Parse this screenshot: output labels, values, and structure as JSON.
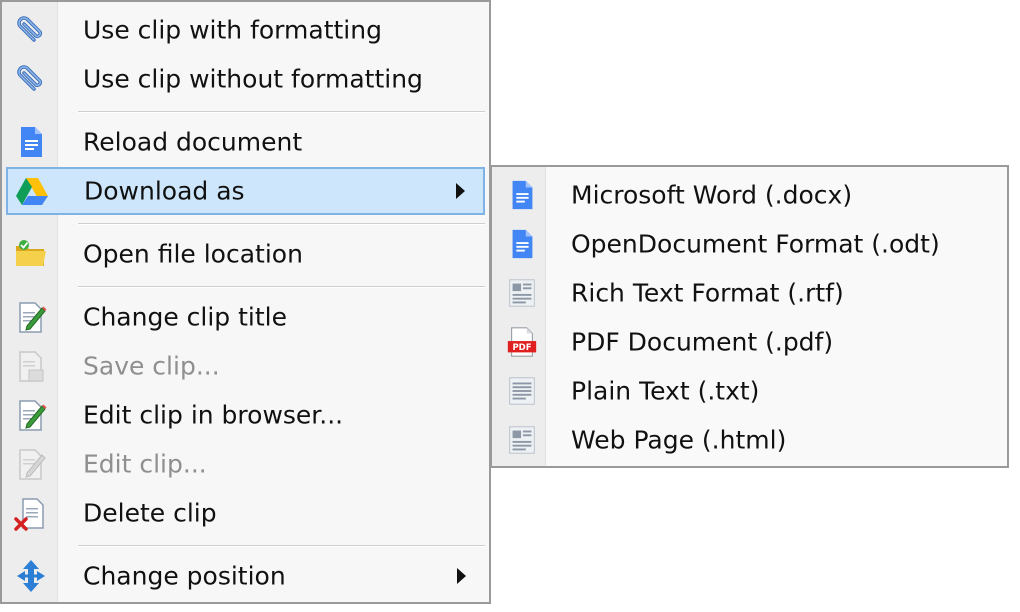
{
  "main_menu": {
    "items": [
      {
        "label": "Use clip with formatting",
        "icon": "paperclip-icon",
        "enabled": true
      },
      {
        "label": "Use clip without formatting",
        "icon": "paperclip-icon",
        "enabled": true
      },
      {
        "label": "Reload document",
        "icon": "google-doc-icon",
        "enabled": true
      },
      {
        "label": "Download as",
        "icon": "google-drive-icon",
        "enabled": true,
        "submenu": true,
        "highlighted": true
      },
      {
        "label": "Open file location",
        "icon": "folder-icon",
        "enabled": true
      },
      {
        "label": "Change clip title",
        "icon": "edit-page-icon",
        "enabled": true
      },
      {
        "label": "Save clip...",
        "icon": "save-page-icon",
        "enabled": false
      },
      {
        "label": "Edit clip in browser...",
        "icon": "edit-page-icon",
        "enabled": true
      },
      {
        "label": "Edit clip...",
        "icon": "edit-page-icon",
        "enabled": false
      },
      {
        "label": "Delete clip",
        "icon": "delete-page-icon",
        "enabled": true
      },
      {
        "label": "Change position",
        "icon": "move-arrows-icon",
        "enabled": true,
        "submenu": true
      }
    ]
  },
  "download_submenu": {
    "items": [
      {
        "label": "Microsoft Word (.docx)",
        "icon": "google-doc-icon"
      },
      {
        "label": "OpenDocument Format (.odt)",
        "icon": "google-doc-icon"
      },
      {
        "label": "Rich Text Format (.rtf)",
        "icon": "text-document-icon"
      },
      {
        "label": "PDF Document (.pdf)",
        "icon": "pdf-icon"
      },
      {
        "label": "Plain Text (.txt)",
        "icon": "text-document-icon"
      },
      {
        "label": "Web Page (.html)",
        "icon": "text-document-icon"
      }
    ]
  },
  "colors": {
    "highlight_fill": "#cde6fb",
    "highlight_border": "#7fb2e6",
    "disabled_text": "#8f8f8f",
    "doc_blue": "#4285f4",
    "pdf_red": "#e02020"
  }
}
